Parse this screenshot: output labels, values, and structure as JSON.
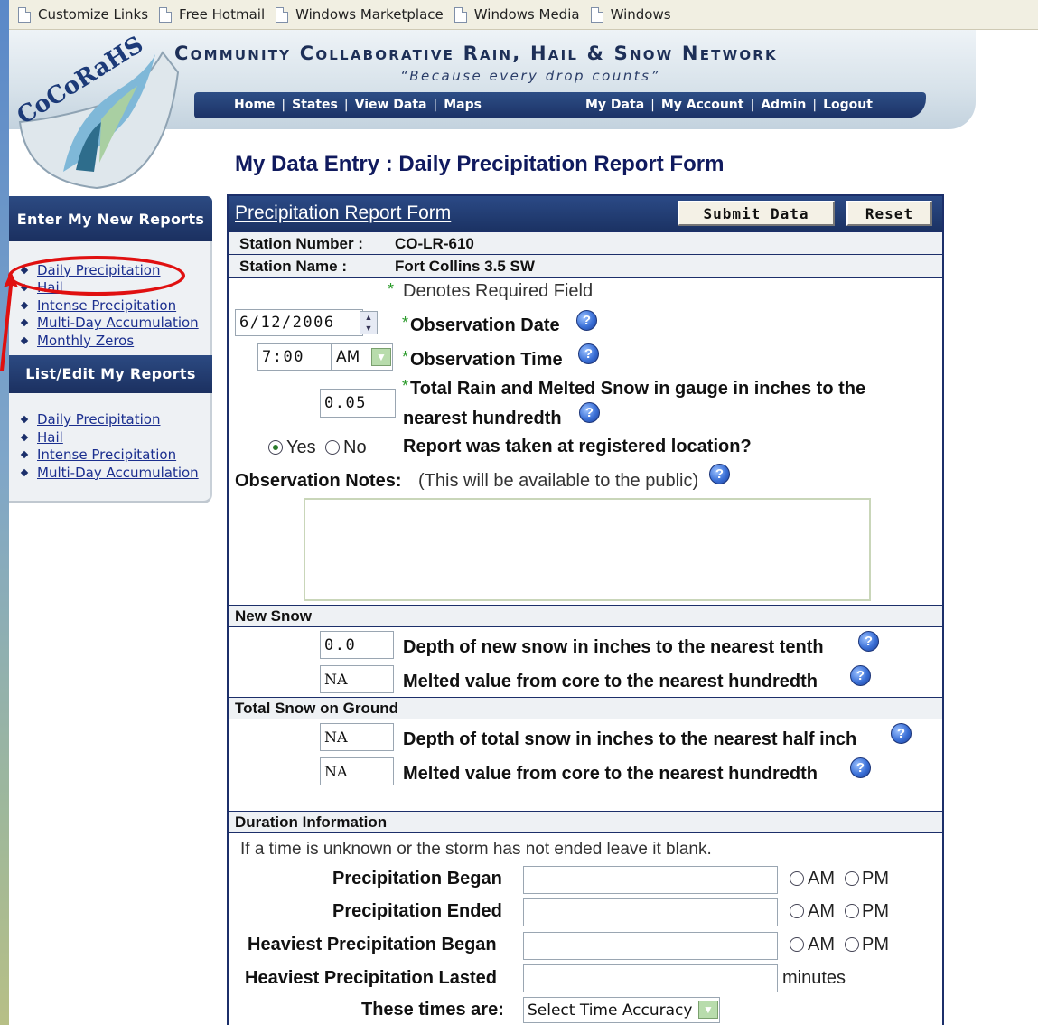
{
  "links_bar": {
    "items": [
      "Customize Links",
      "Free Hotmail",
      "Windows Marketplace",
      "Windows Media",
      "Windows"
    ]
  },
  "header": {
    "logo_text": "CoCoRaHS",
    "title": "Community Collaborative Rain, Hail & Snow Network",
    "tagline": "“Because every drop counts”",
    "nav_left": [
      "Home",
      "States",
      "View Data",
      "Maps"
    ],
    "nav_right": [
      "My Data",
      "My Account",
      "Admin",
      "Logout"
    ]
  },
  "page_heading": "My Data Entry : Daily Precipitation Report Form",
  "sidebar": {
    "new_reports_title": "Enter My New Reports",
    "new_reports": [
      "Daily Precipitation",
      "Hail",
      "Intense Precipitation",
      "Multi-Day Accumulation",
      "Monthly Zeros"
    ],
    "list_edit_title": "List/Edit My Reports",
    "list_edit": [
      "Daily Precipitation",
      "Hail",
      "Intense Precipitation",
      "Multi-Day Accumulation"
    ]
  },
  "form": {
    "title": "Precipitation Report Form",
    "submit_label": "Submit Data",
    "reset_label": "Reset",
    "station_number_label": "Station Number :",
    "station_number": "CO-LR-610",
    "station_name_label": "Station Name :",
    "station_name": "Fort Collins 3.5 SW",
    "required_star": "*",
    "required_note": "Denotes Required Field",
    "observation_date": {
      "value": "6/12/2006",
      "label": "Observation Date"
    },
    "observation_time": {
      "value": "7:00",
      "ampm": "AM",
      "label": "Observation Time"
    },
    "total_rain": {
      "value": "0.05",
      "label_line1": "Total Rain and Melted Snow in gauge in inches to the",
      "label_line2": "nearest hundredth"
    },
    "registered_location": {
      "yes": "Yes",
      "no": "No",
      "selected": "Yes",
      "label": "Report was taken at registered location?"
    },
    "notes": {
      "label": "Observation Notes:",
      "hint": "(This will be available to the public)",
      "value": ""
    },
    "new_snow": {
      "section": "New Snow",
      "depth_value": "0.0",
      "depth_label": "Depth of new snow in inches to the nearest tenth",
      "melted_value": "NA",
      "melted_label": "Melted value from core to the nearest hundredth"
    },
    "total_snow": {
      "section": "Total Snow on Ground",
      "depth_value": "NA",
      "depth_label": "Depth of total snow in inches to the nearest half inch",
      "melted_value": "NA",
      "melted_label": "Melted value from core to the nearest hundredth"
    },
    "duration": {
      "section": "Duration Information",
      "hint": "If a time is unknown or the storm has not ended leave it blank.",
      "am": "AM",
      "pm": "PM",
      "precip_began": "Precipitation Began",
      "precip_ended": "Precipitation Ended",
      "heaviest_began": "Heaviest Precipitation Began",
      "heaviest_lasted": "Heaviest Precipitation Lasted",
      "minutes": "minutes",
      "times_are": "These times are:",
      "time_accuracy": "Select Time Accuracy"
    }
  },
  "colors": {
    "navy": "#1c2f6a",
    "link": "#1b2f8f",
    "annotation": "#e01010"
  }
}
